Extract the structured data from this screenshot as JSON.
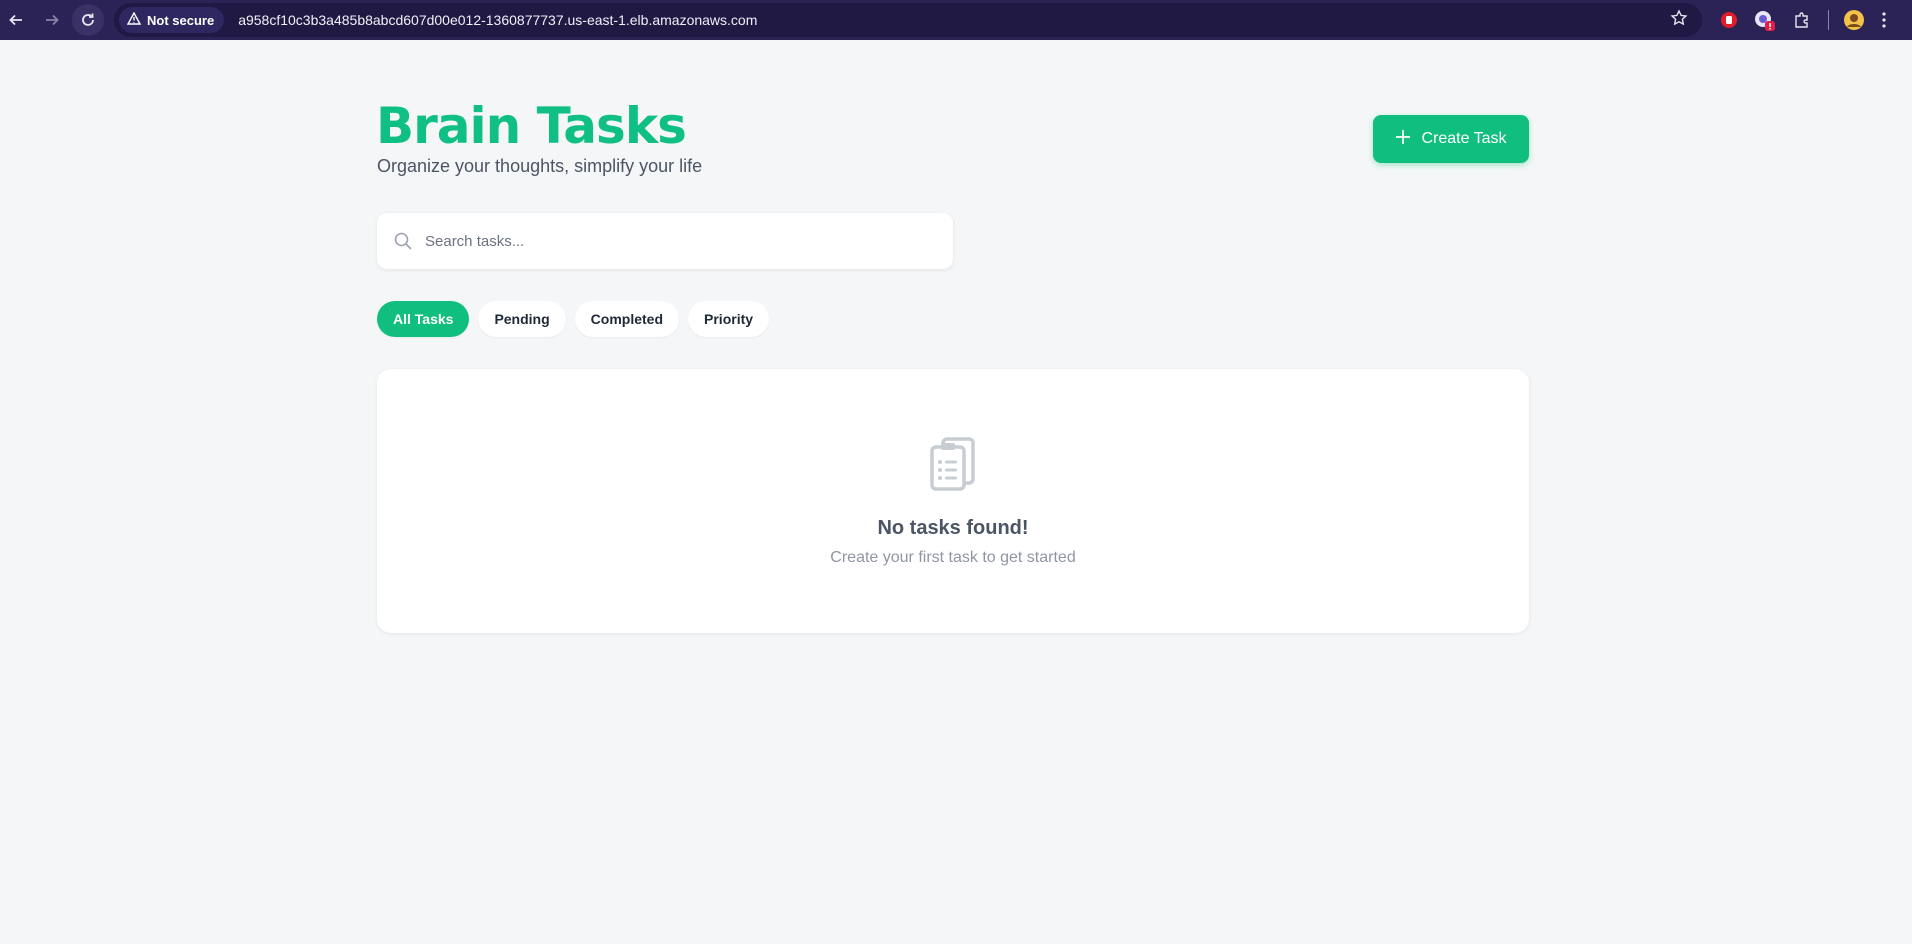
{
  "browser": {
    "security_label": "Not secure",
    "url": "a958cf10c3b3a485b8abcd607d00e012-1360877737.us-east-1.elb.amazonaws.com"
  },
  "header": {
    "title": "Brain Tasks",
    "subtitle": "Organize your thoughts, simplify your life",
    "create_label": "Create Task"
  },
  "search": {
    "placeholder": "Search tasks..."
  },
  "filters": [
    {
      "label": "All Tasks",
      "active": true
    },
    {
      "label": "Pending",
      "active": false
    },
    {
      "label": "Completed",
      "active": false
    },
    {
      "label": "Priority",
      "active": false
    }
  ],
  "empty_state": {
    "title": "No tasks found!",
    "message": "Create your first task to get started"
  },
  "colors": {
    "accent": "#10bf7d",
    "chrome": "#2b2355"
  }
}
